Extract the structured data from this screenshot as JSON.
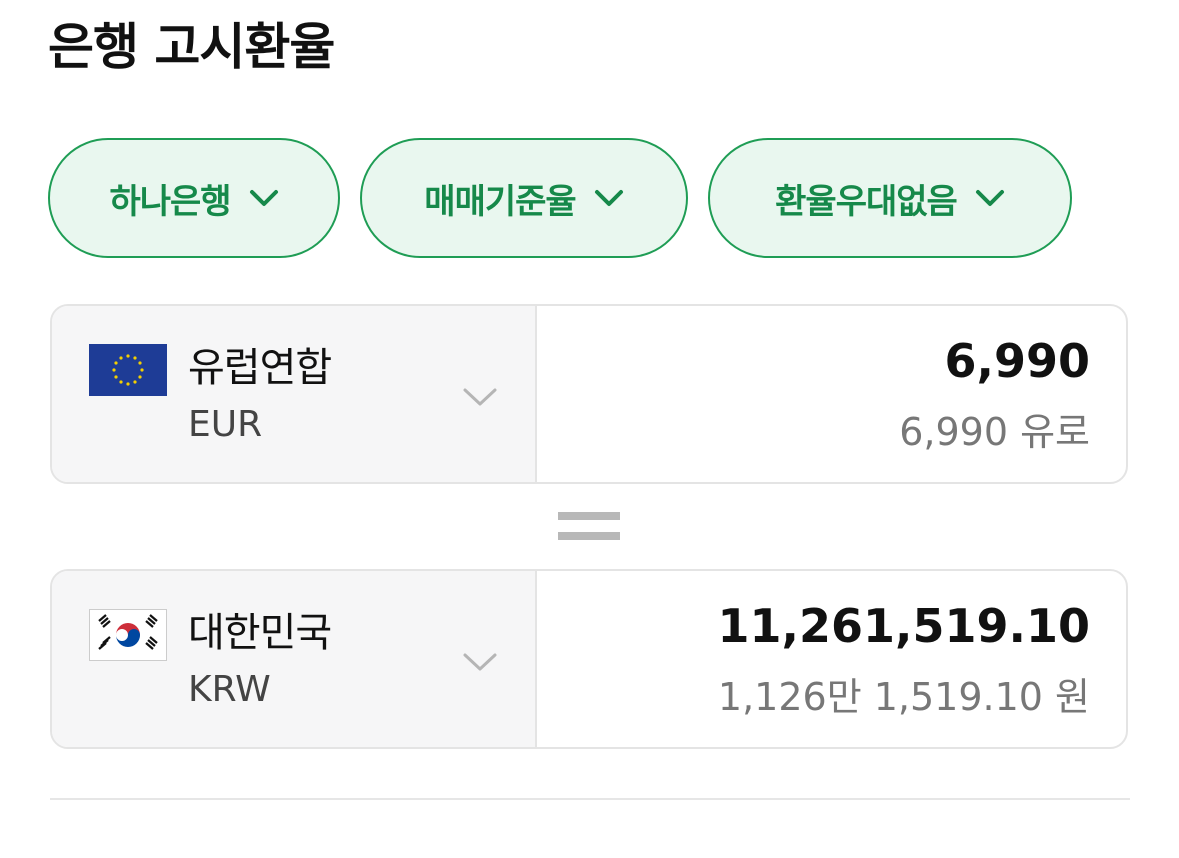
{
  "header": {
    "title": "은행 고시환율"
  },
  "filters": [
    {
      "label": "하나은행",
      "icon": "chevron-down-icon"
    },
    {
      "label": "매매기준율",
      "icon": "chevron-down-icon"
    },
    {
      "label": "환율우대없음",
      "icon": "chevron-down-icon"
    }
  ],
  "from": {
    "country": "유럽연합",
    "code": "EUR",
    "flag": "eu-flag-icon",
    "amount": "6,990",
    "amount_text": "6,990 유로"
  },
  "to": {
    "country": "대한민국",
    "code": "KRW",
    "flag": "kr-flag-icon",
    "amount": "11,261,519.10",
    "amount_text": "1,126만 1,519.10 원"
  },
  "colors": {
    "accent": "#16894a",
    "chip_bg": "#e9f7ef",
    "chip_border": "#1f9d55"
  }
}
